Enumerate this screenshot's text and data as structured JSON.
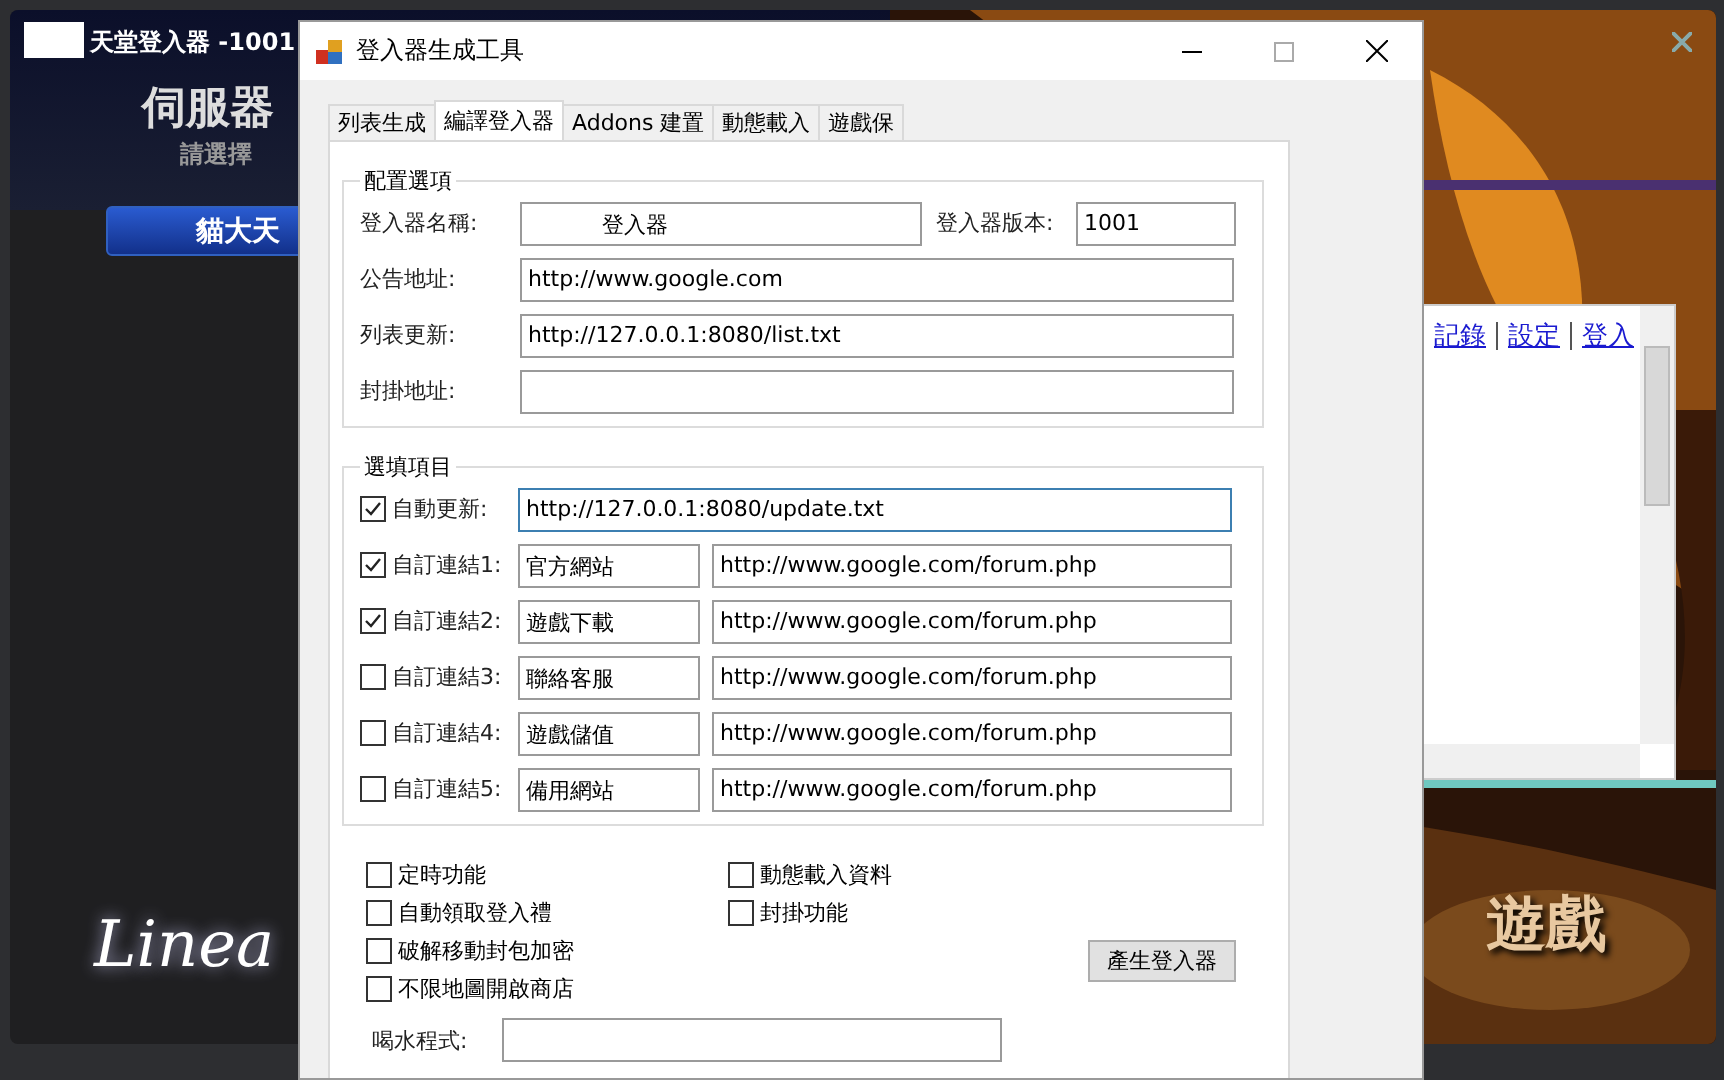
{
  "launcher": {
    "title": "天堂登入器 -1001",
    "heading": "伺服器",
    "subtitle": "請選擇",
    "server_button": "貓大天",
    "logo": "Linea",
    "links": [
      "記錄",
      "設定",
      "登入"
    ],
    "banner": "遊戲"
  },
  "dialog": {
    "title": "登入器生成工具",
    "tabs": [
      {
        "label": "列表生成",
        "selected": false
      },
      {
        "label": "編譯登入器",
        "selected": true
      },
      {
        "label": "Addons 建置",
        "selected": false
      },
      {
        "label": "動態載入",
        "selected": false
      },
      {
        "label": "遊戲保",
        "selected": false
      }
    ],
    "config": {
      "legend": "配置選項",
      "name_label": "登入器名稱:",
      "name_value": "登入器",
      "version_label": "登入器版本:",
      "version_value": "1001",
      "fields": [
        {
          "label": "公告地址:",
          "value": "http://www.google.com"
        },
        {
          "label": "列表更新:",
          "value": "http://127.0.0.1:8080/list.txt"
        },
        {
          "label": "封掛地址:"
        }
      ]
    },
    "options": {
      "legend": "選填項目",
      "rows": [
        {
          "kind": "single",
          "label": "自動更新:",
          "checked": true,
          "focused": true,
          "value": "http://127.0.0.1:8080/update.txt"
        },
        {
          "kind": "pair",
          "label": "自訂連結1:",
          "checked": true,
          "focused": false,
          "name": "官方網站",
          "url": "http://www.google.com/forum.php"
        },
        {
          "kind": "pair",
          "label": "自訂連結2:",
          "checked": true,
          "focused": false,
          "name": "遊戲下載",
          "url": "http://www.google.com/forum.php"
        },
        {
          "kind": "pair",
          "label": "自訂連結3:",
          "checked": false,
          "focused": false,
          "name": "聯絡客服",
          "url": "http://www.google.com/forum.php"
        },
        {
          "kind": "pair",
          "label": "自訂連結4:",
          "checked": false,
          "focused": false,
          "name": "遊戲儲值",
          "url": "http://www.google.com/forum.php"
        },
        {
          "kind": "pair",
          "label": "自訂連結5:",
          "checked": false,
          "focused": false,
          "name": "備用網站",
          "url": "http://www.google.com/forum.php"
        }
      ]
    },
    "feature_columns": [
      [
        {
          "label": "定時功能",
          "checked": false
        },
        {
          "label": "自動領取登入禮",
          "checked": false
        },
        {
          "label": "破解移動封包加密",
          "checked": false
        },
        {
          "label": "不限地圖開啟商店",
          "checked": false
        }
      ],
      [
        {
          "label": "動態載入資料",
          "checked": false
        },
        {
          "label": "封掛功能",
          "checked": false
        }
      ]
    ],
    "generate_button": "產生登入器",
    "drink": {
      "label": "喝水程式:"
    }
  }
}
